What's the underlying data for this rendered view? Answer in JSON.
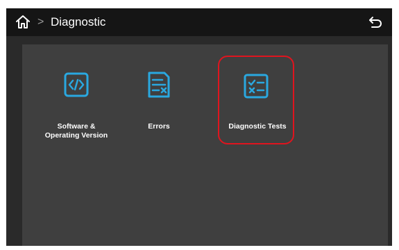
{
  "header": {
    "title": "Diagnostic",
    "separator": ">",
    "home_icon": "home-icon",
    "back_icon": "undo-arrow-icon"
  },
  "tiles": [
    {
      "label": "Software &\nOperating Version",
      "icon": "code-brackets-icon"
    },
    {
      "label": "Errors",
      "icon": "document-x-icon"
    },
    {
      "label": "Diagnostic Tests",
      "icon": "checklist-icon",
      "selected": true
    }
  ],
  "colors": {
    "accent": "#2aa8e0",
    "selection": "#e0141e",
    "topbar": "#151515",
    "panel": "#3f3f3f",
    "background": "#2a2a2a"
  }
}
